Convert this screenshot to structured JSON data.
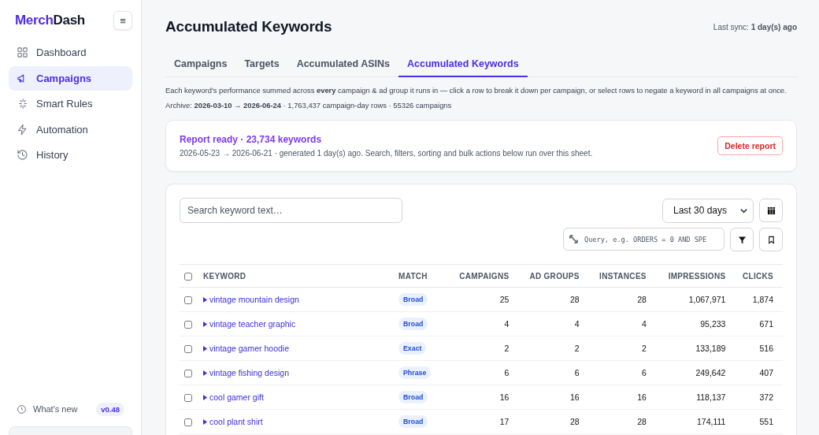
{
  "sidebar": {
    "logo": {
      "brand": "Merch",
      "suffix": "Dash"
    },
    "menu_button": "≡",
    "items": [
      {
        "label": "Dashboard",
        "selected": false
      },
      {
        "label": "Campaigns",
        "selected": true
      },
      {
        "label": "Smart Rules",
        "selected": false
      },
      {
        "label": "Automation",
        "selected": false
      },
      {
        "label": "History",
        "selected": false
      }
    ],
    "whats_new": {
      "label": "What's new",
      "version": "v0.48"
    }
  },
  "header": {
    "title": "Accumulated Keywords",
    "last_sync": "Last sync: **1 day(s) ago**"
  },
  "tabs": [
    {
      "label": "Campaigns",
      "selected": false
    },
    {
      "label": "Targets",
      "selected": false
    },
    {
      "label": "Accumulated ASINs",
      "selected": false
    },
    {
      "label": "Accumulated Keywords",
      "selected": true
    }
  ],
  "description": "Each keyword's performance summed across **every** campaign & ad group it runs in — click a row to break it down per campaign, or select rows to negate a keyword in all campaigns at once.",
  "archive": "Archive: **2026-03-10 → 2026-06-24** · 1,763,437 campaign-day rows · 55326 campaigns",
  "report": {
    "title": "Report ready · 23,734 keywords",
    "details": "2026-05-23 → 2026-06-21 · generated 1 day(s) ago. Search, filters, sorting and bulk actions below run over this sheet.",
    "delete_button": "Delete report"
  },
  "toolbar": {
    "search_placeholder": "Search keyword text…",
    "range": "Last 30 days",
    "query_placeholder": "Query, e.g. ORDERS = 0 AND SPE"
  },
  "table": {
    "columns": [
      "KEYWORD",
      "MATCH",
      "CAMPAIGNS",
      "AD GROUPS",
      "INSTANCES",
      "IMPRESSIONS",
      "CLICKS"
    ],
    "header_checked": false,
    "rows": [
      {
        "checked": false,
        "keyword": "vintage mountain design",
        "match": "Broad",
        "campaigns": "25",
        "ad_groups": "28",
        "instances": "28",
        "impressions": "1,067,971",
        "clicks": "1,874"
      },
      {
        "checked": false,
        "keyword": "vintage teacher graphic",
        "match": "Broad",
        "campaigns": "4",
        "ad_groups": "4",
        "instances": "4",
        "impressions": "95,233",
        "clicks": "671"
      },
      {
        "checked": false,
        "keyword": "vintage gamer hoodie",
        "match": "Exact",
        "campaigns": "2",
        "ad_groups": "2",
        "instances": "2",
        "impressions": "133,189",
        "clicks": "516"
      },
      {
        "checked": false,
        "keyword": "vintage fishing design",
        "match": "Phrase",
        "campaigns": "6",
        "ad_groups": "6",
        "instances": "6",
        "impressions": "249,642",
        "clicks": "407"
      },
      {
        "checked": false,
        "keyword": "cool gamer gift",
        "match": "Broad",
        "campaigns": "16",
        "ad_groups": "16",
        "instances": "16",
        "impressions": "118,137",
        "clicks": "372"
      },
      {
        "checked": false,
        "keyword": "cool plant shirt",
        "match": "Broad",
        "campaigns": "17",
        "ad_groups": "28",
        "instances": "28",
        "impressions": "174,111",
        "clicks": "551"
      }
    ]
  }
}
